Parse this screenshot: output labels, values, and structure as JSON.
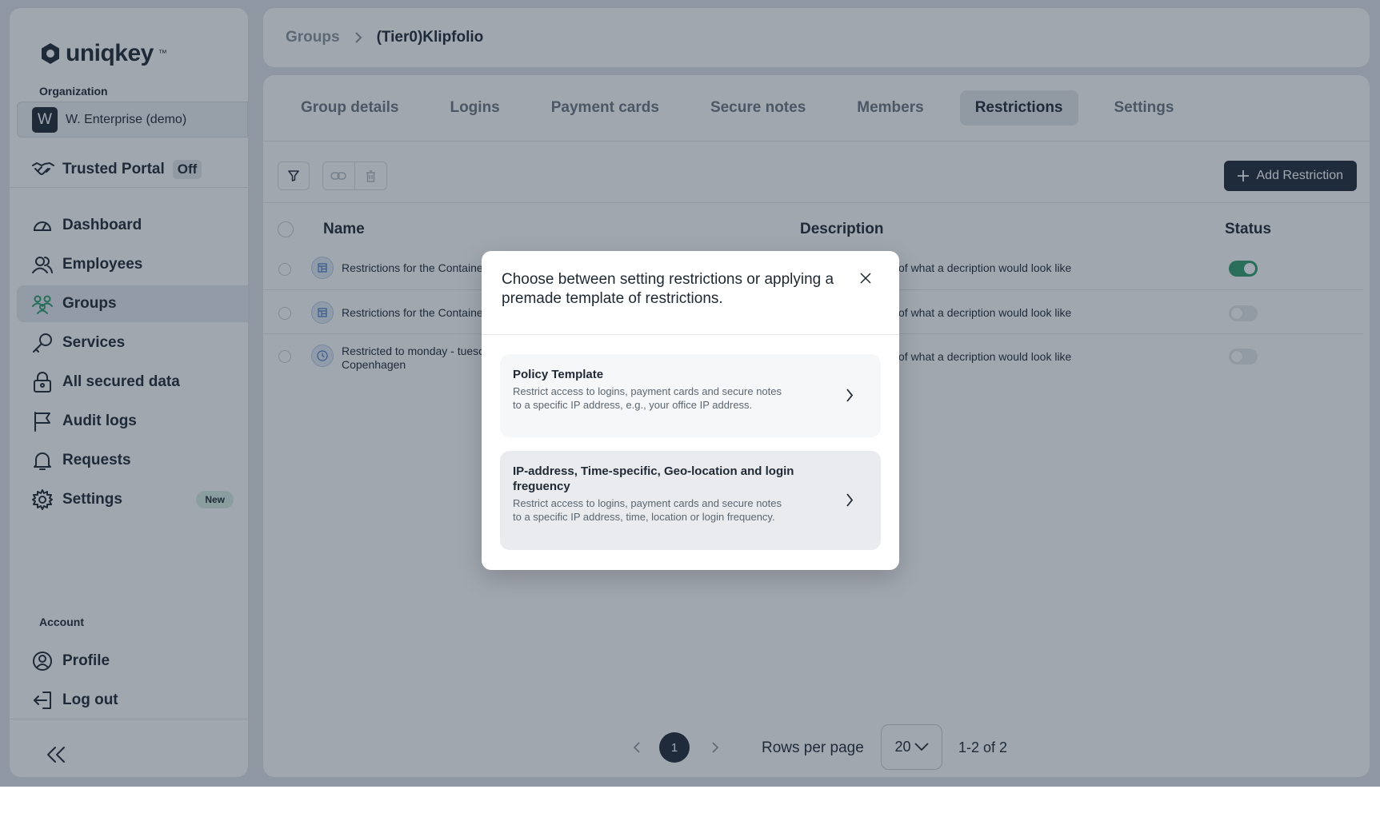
{
  "brand": {
    "name": "uniqkey",
    "tm": "™"
  },
  "sidebar": {
    "org_label": "Organization",
    "org_initial": "W",
    "org_name": "W. Enterprise (demo)",
    "trusted_label": "Trusted Portal",
    "trusted_state": "Off",
    "items": [
      {
        "label": "Dashboard",
        "icon": "dashboard-icon"
      },
      {
        "label": "Employees",
        "icon": "employees-icon"
      },
      {
        "label": "Groups",
        "icon": "groups-icon",
        "active": true
      },
      {
        "label": "Services",
        "icon": "key-icon"
      },
      {
        "label": "All secured data",
        "icon": "lock-icon"
      },
      {
        "label": "Audit logs",
        "icon": "flag-icon"
      },
      {
        "label": "Requests",
        "icon": "bell-icon"
      },
      {
        "label": "Settings",
        "icon": "gear-icon",
        "badge": "New"
      }
    ],
    "account_label": "Account",
    "account_items": [
      {
        "label": "Profile",
        "icon": "profile-icon"
      },
      {
        "label": "Log out",
        "icon": "logout-icon"
      }
    ]
  },
  "breadcrumb": {
    "parent": "Groups",
    "current": "(Tier0)Klipfolio"
  },
  "tabs": [
    "Group details",
    "Logins",
    "Payment cards",
    "Secure notes",
    "Members",
    "Restrictions",
    "Settings"
  ],
  "active_tab": "Restrictions",
  "toolbar": {
    "add_label": "Add Restriction"
  },
  "table": {
    "columns": {
      "name": "Name",
      "description": "Description",
      "status": "Status"
    },
    "rows": [
      {
        "name": "Restrictions for the Containe",
        "description": "of what a decription would look like",
        "enabled": true,
        "icon": "template-icon"
      },
      {
        "name": "Restrictions for the Containe",
        "description": "of what a decription would look like",
        "enabled": false,
        "icon": "template-icon"
      },
      {
        "name_line1": "Restricted to monday - tuesc",
        "name_line2": "Copenhagen",
        "description": "of what a decription would look like",
        "enabled": false,
        "icon": "clock-icon"
      }
    ]
  },
  "pagination": {
    "current_page": "1",
    "rows_label": "Rows per page",
    "rows_value": "20",
    "range": "1-2 of 2"
  },
  "modal": {
    "title": "Choose between setting restrictions or applying a premade template  of restrictions.",
    "options": [
      {
        "title": "Policy Template",
        "description": "Restrict access to logins, payment cards and secure notes to a specific IP address, e.g., your office IP address."
      },
      {
        "title": "IP-address, Time-specific, Geo-location and login freguency",
        "description": "Restrict access to logins, payment cards and secure notes to a specific IP address, time, location or login frequency."
      }
    ]
  },
  "colors": {
    "accent": "#1f2a36",
    "toggle_on": "#2f9e6e",
    "badge_new": "#d8f0e3"
  }
}
